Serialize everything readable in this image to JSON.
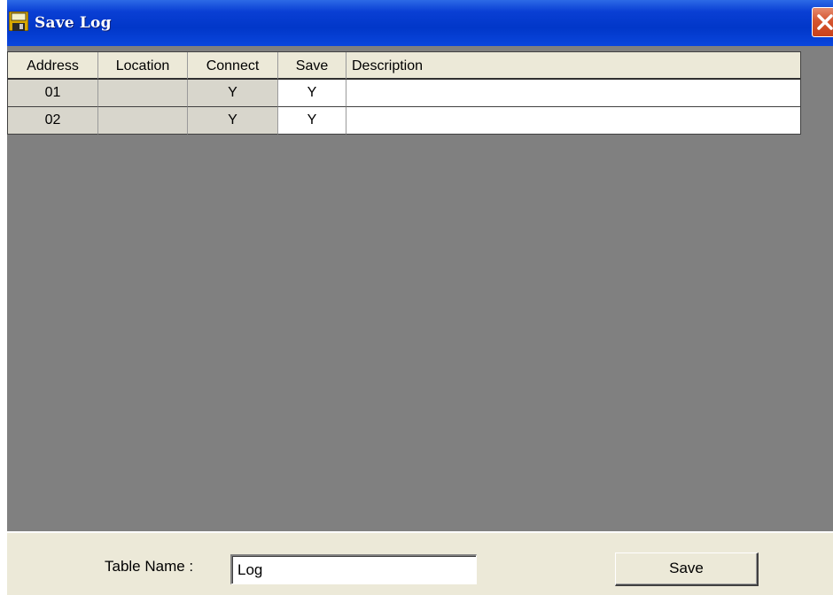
{
  "window": {
    "title": "Save Log",
    "icon": "save-log-window-icon",
    "close_icon": "close-icon"
  },
  "grid": {
    "columns": [
      "Address",
      "Location",
      "Connect",
      "Save",
      "Description"
    ],
    "rows": [
      {
        "address": "01",
        "location": "",
        "connect": "Y",
        "save": "Y",
        "description": ""
      },
      {
        "address": "02",
        "location": "",
        "connect": "Y",
        "save": "Y",
        "description": ""
      }
    ]
  },
  "footer": {
    "table_name_label": "Table Name :",
    "table_name_value": "Log",
    "save_label": "Save"
  },
  "colors": {
    "titlebar": "#0137c9",
    "grid_background": "#808080",
    "panel": "#ece9d8",
    "close_button": "#d5552f"
  }
}
